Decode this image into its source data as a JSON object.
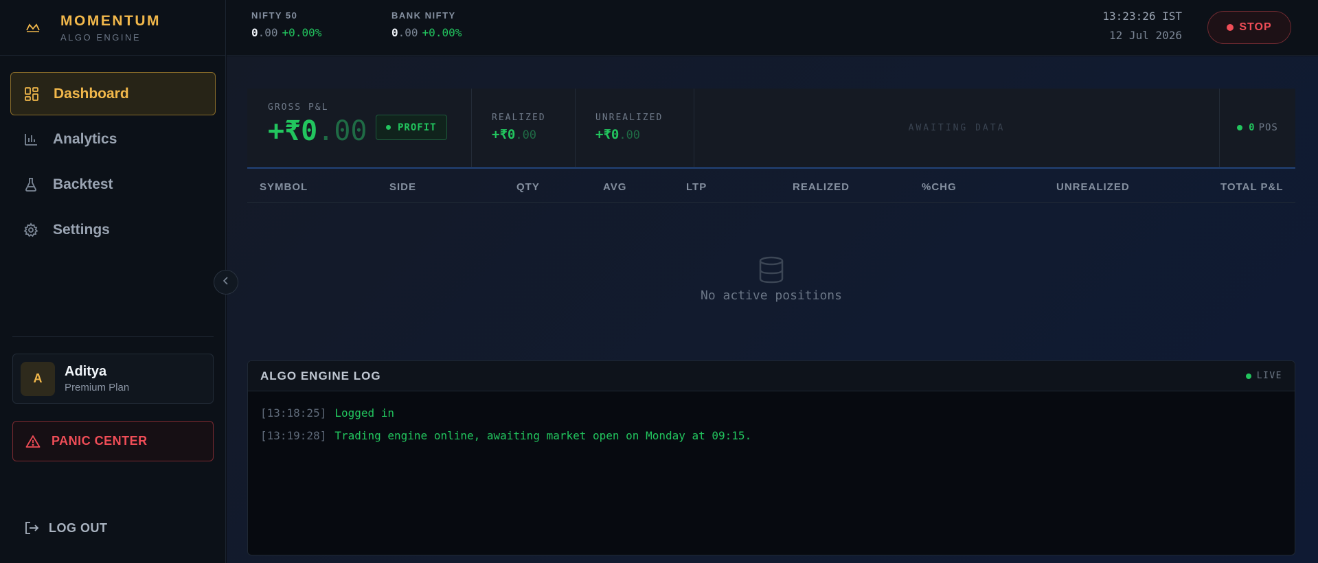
{
  "brand": {
    "title": "MOMENTUM",
    "subtitle": "ALGO ENGINE",
    "accent": "#f2b84b"
  },
  "sidebar": {
    "items": [
      {
        "label": "Dashboard",
        "icon": "dashboard-grid-icon",
        "active": true
      },
      {
        "label": "Analytics",
        "icon": "bar-chart-icon",
        "active": false
      },
      {
        "label": "Backtest",
        "icon": "flask-icon",
        "active": false
      },
      {
        "label": "Settings",
        "icon": "gear-icon",
        "active": false
      }
    ],
    "collapse_icon": "chevron-left-icon"
  },
  "user": {
    "initial": "A",
    "name": "Aditya",
    "plan": "Premium Plan"
  },
  "panic": {
    "label": "PANIC CENTER",
    "icon": "warning-triangle-icon",
    "color": "#ef4d57"
  },
  "logout": {
    "label": "LOG OUT",
    "icon": "logout-icon"
  },
  "header": {
    "tickers": [
      {
        "label": "NIFTY 50",
        "int": "0",
        "dec": ".00",
        "change": "+0.00%"
      },
      {
        "label": "BANK NIFTY",
        "int": "0",
        "dec": ".00",
        "change": "+0.00%"
      }
    ],
    "time": "13:23:26 IST",
    "date": "12 Jul 2026",
    "stop_label": "STOP"
  },
  "pnl": {
    "gross_label": "GROSS P&L",
    "gross_int": "+₹0",
    "gross_dec": ".00",
    "badge": "PROFIT",
    "realized_label": "REALIZED",
    "realized_int": "+₹0",
    "realized_dec": ".00",
    "unrealized_label": "UNREALIZED",
    "unrealized_int": "+₹0",
    "unrealized_dec": ".00",
    "awaiting": "AWAITING DATA",
    "pos_count": "0",
    "pos_label": "POS"
  },
  "table": {
    "columns": [
      "SYMBOL",
      "SIDE",
      "QTY",
      "AVG",
      "LTP",
      "REALIZED",
      "%CHG",
      "UNREALIZED",
      "TOTAL P&L"
    ],
    "empty_message": "No active positions",
    "empty_icon": "database-icon"
  },
  "log": {
    "title": "ALGO ENGINE LOG",
    "status": "LIVE",
    "lines": [
      {
        "ts": "[13:18:25]",
        "text": "Logged in"
      },
      {
        "ts": "[13:19:28]",
        "text": "Trading engine online, awaiting market open on Monday at 09:15."
      }
    ]
  },
  "colors": {
    "profit": "#22c55e",
    "danger": "#ef4d57",
    "background": "#0b0f17"
  }
}
